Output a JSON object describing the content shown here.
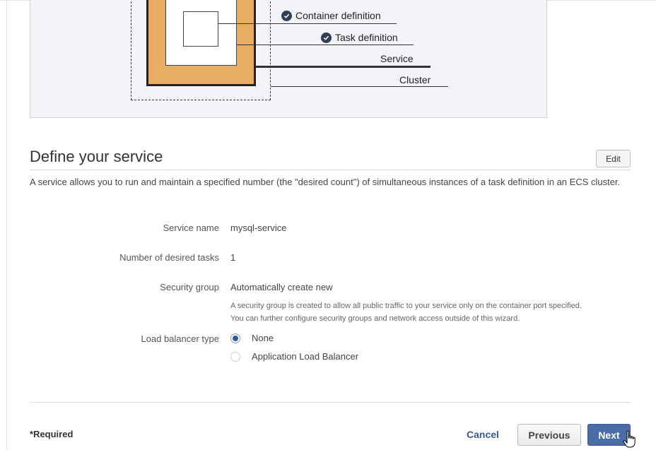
{
  "diagram": {
    "labels": {
      "container_definition": "Container definition",
      "task_definition": "Task definition",
      "service": "Service",
      "cluster": "Cluster"
    },
    "icons": {
      "check": "check-circle-icon"
    }
  },
  "section": {
    "title": "Define your service",
    "edit_label": "Edit",
    "description": "A service allows you to run and maintain a specified number (the \"desired count\") of simultaneous instances of a task definition in an ECS cluster."
  },
  "fields": {
    "service_name": {
      "label": "Service name",
      "value": "mysql-service"
    },
    "desired_tasks": {
      "label": "Number of desired tasks",
      "value": "1"
    },
    "security_group": {
      "label": "Security group",
      "value": "Automatically create new",
      "help_line1": "A security group is created to allow all public traffic to your service only on the container port specified.",
      "help_line2": "You can further configure security groups and network access outside of this wizard."
    },
    "load_balancer": {
      "label": "Load balancer type",
      "options": [
        "None",
        "Application Load Balancer"
      ],
      "selected": "None"
    }
  },
  "footer": {
    "required_note": "*Required",
    "cancel_label": "Cancel",
    "previous_label": "Previous",
    "next_label": "Next"
  },
  "colors": {
    "primary_button": "#4a6da8",
    "link": "#3a5a93",
    "cluster_fill": "#e8ad62",
    "radio_selected": "#2f5a9e"
  }
}
